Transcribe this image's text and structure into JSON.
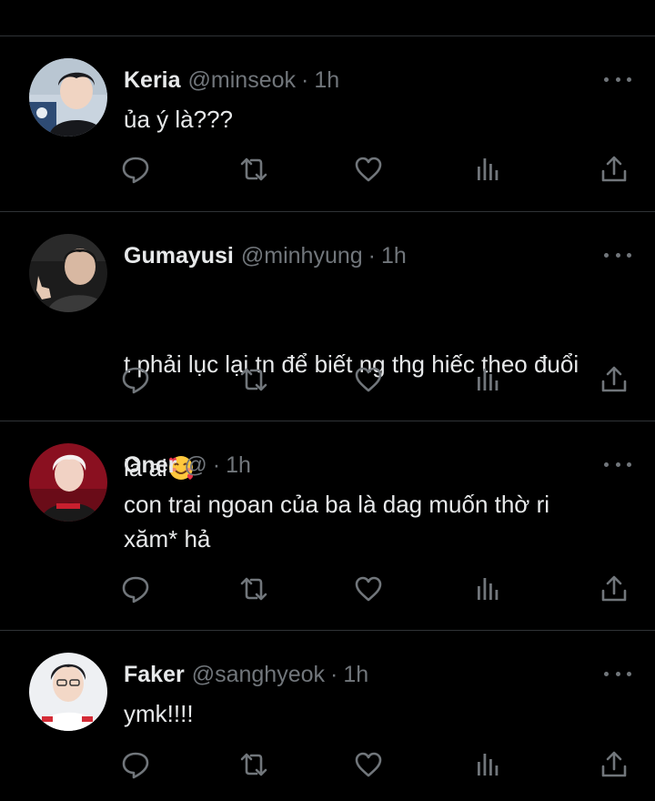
{
  "tweets": [
    {
      "name": "Keria",
      "handle": "@minseok",
      "dot": "·",
      "time": "1h",
      "text": "ủa ý là???",
      "avatar": "keria-avatar"
    },
    {
      "name": "Gumayusi",
      "handle": "@minhyung",
      "dot": "·",
      "time": "1h",
      "text_lines": [
        "t phải lục lại tn để biết ng thg hiếc theo đuổi",
        "là ai"
      ],
      "emoji": "smiling-face-with-hearts-emoji",
      "avatar": "gumayusi-avatar"
    },
    {
      "name": "Oner",
      "handle": "@",
      "dot": "·",
      "time": "1h",
      "text": "con trai ngoan của ba là dag muốn thờ ri\nxăm* hả",
      "avatar": "oner-avatar"
    },
    {
      "name": "Faker",
      "handle": "@sanghyeok",
      "dot": "·",
      "time": "1h",
      "text": "ymk!!!!",
      "avatar": "faker-avatar"
    }
  ],
  "action_icons": [
    "reply-icon",
    "retweet-icon",
    "like-icon",
    "views-icon",
    "share-icon"
  ],
  "colors": {
    "background": "#000000",
    "text": "#e7e9ea",
    "secondary": "#71767b",
    "divider": "#2f3336"
  }
}
